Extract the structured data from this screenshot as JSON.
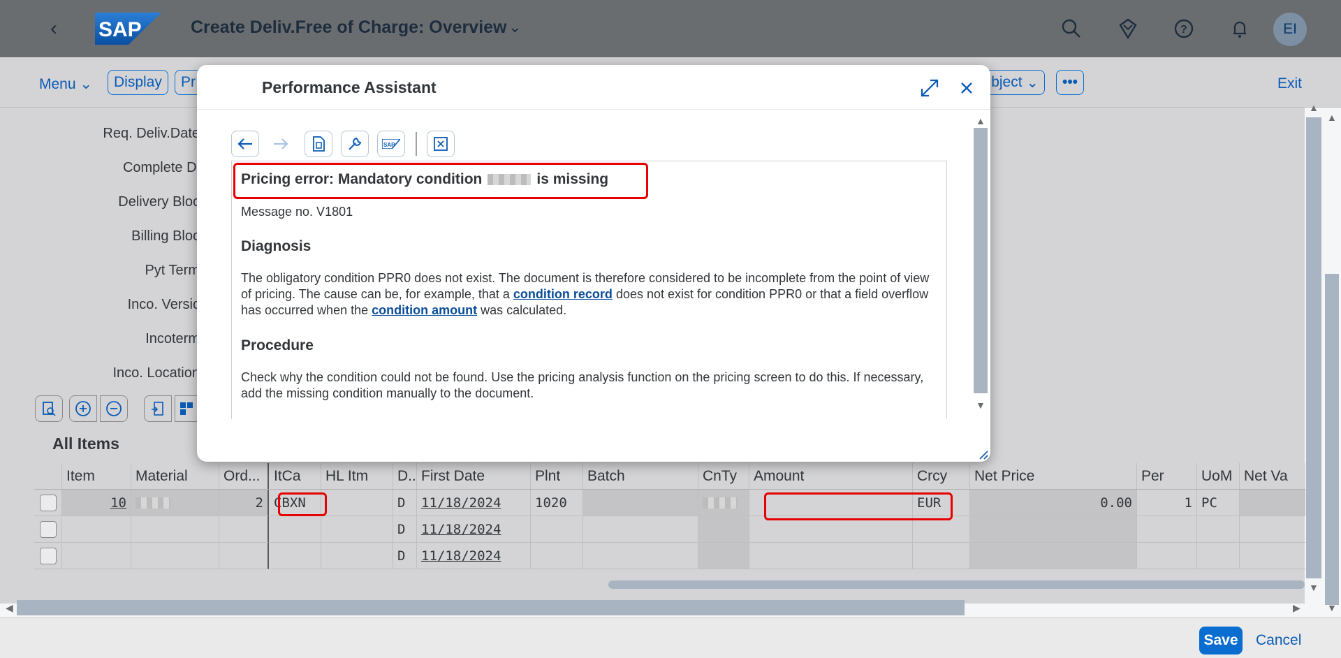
{
  "shell": {
    "logo_text": "SAP",
    "title": "Create Deliv.Free of Charge: Overview",
    "avatar_initials": "EI"
  },
  "toolbar": {
    "menu": "Menu",
    "display": "Display",
    "pr_partial": "Pr",
    "object_partial": "bject",
    "exit": "Exit"
  },
  "form_labels": [
    "Req. Deliv.Date",
    "Complete Dl",
    "Delivery Bloc",
    "Billing Bloc",
    "Pyt Term",
    "Inco. Versic",
    "Incoterm",
    "Inco. Location"
  ],
  "table": {
    "title": "All Items",
    "columns": [
      "Item",
      "Material",
      "Ord...",
      "ItCa",
      "HL Itm",
      "D..",
      "First Date",
      "Plnt",
      "Batch",
      "CnTy",
      "Amount",
      "Crcy",
      "Net Price",
      "Per",
      "UoM",
      "Net Va"
    ],
    "rows": [
      {
        "item": "10",
        "ord": "2",
        "itca": "CBXN",
        "d": "D",
        "first_date": "11/18/2024",
        "plnt": "1020",
        "crcy": "EUR",
        "net_price": "0.00",
        "per": "1",
        "uom": "PC"
      },
      {
        "item": "",
        "ord": "",
        "itca": "",
        "d": "D",
        "first_date": "11/18/2024",
        "plnt": "",
        "crcy": "",
        "net_price": "",
        "per": "",
        "uom": ""
      },
      {
        "item": "",
        "ord": "",
        "itca": "",
        "d": "D",
        "first_date": "11/18/2024",
        "plnt": "",
        "crcy": "",
        "net_price": "",
        "per": "",
        "uom": ""
      }
    ]
  },
  "footer": {
    "save": "Save",
    "cancel": "Cancel"
  },
  "dialog": {
    "title": "Performance Assistant",
    "heading_before": "Pricing error: Mandatory condition",
    "heading_after": "is missing",
    "message_no": "Message no. V1801",
    "diagnosis_title": "Diagnosis",
    "diagnosis_part1": "The obligatory condition PPR0 does not exist. The document is therefore considered to be incomplete from the point of view of pricing. The cause can be, for example, that a",
    "diagnosis_link1": "condition record",
    "diagnosis_part2": "does not exist for condition PPR0 or that a field overflow has occurred when the",
    "diagnosis_link2": "condition amount",
    "diagnosis_part3": "was calculated.",
    "procedure_title": "Procedure",
    "procedure_text": "Check why the condition could not be found. Use the pricing analysis function on the pricing screen to do this. If necessary, add the missing condition manually to the document."
  },
  "colors": {
    "accent": "#0a6ed1",
    "highlight": "#e60000",
    "shell_bg": "#6a6d70"
  }
}
